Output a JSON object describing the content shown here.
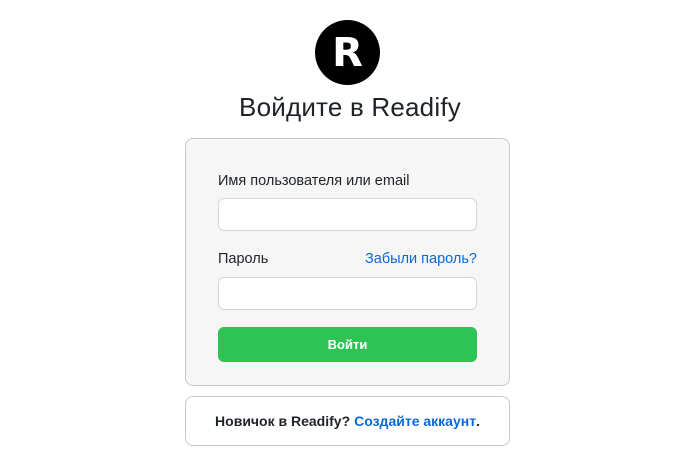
{
  "logo": {
    "letter": "R"
  },
  "heading": "Войдите в Readify",
  "login_form": {
    "username_label": "Имя пользователя или email",
    "username_value": "",
    "password_label": "Пароль",
    "password_value": "",
    "forgot_link": "Забыли пароль?",
    "submit_label": "Войти"
  },
  "signup": {
    "prompt": "Новичок в Readify?",
    "link": "Создайте аккаунт",
    "suffix": "."
  },
  "colors": {
    "accent_green": "#2fc254",
    "link_blue": "#0969da",
    "card_bg": "#f6f6f6"
  }
}
